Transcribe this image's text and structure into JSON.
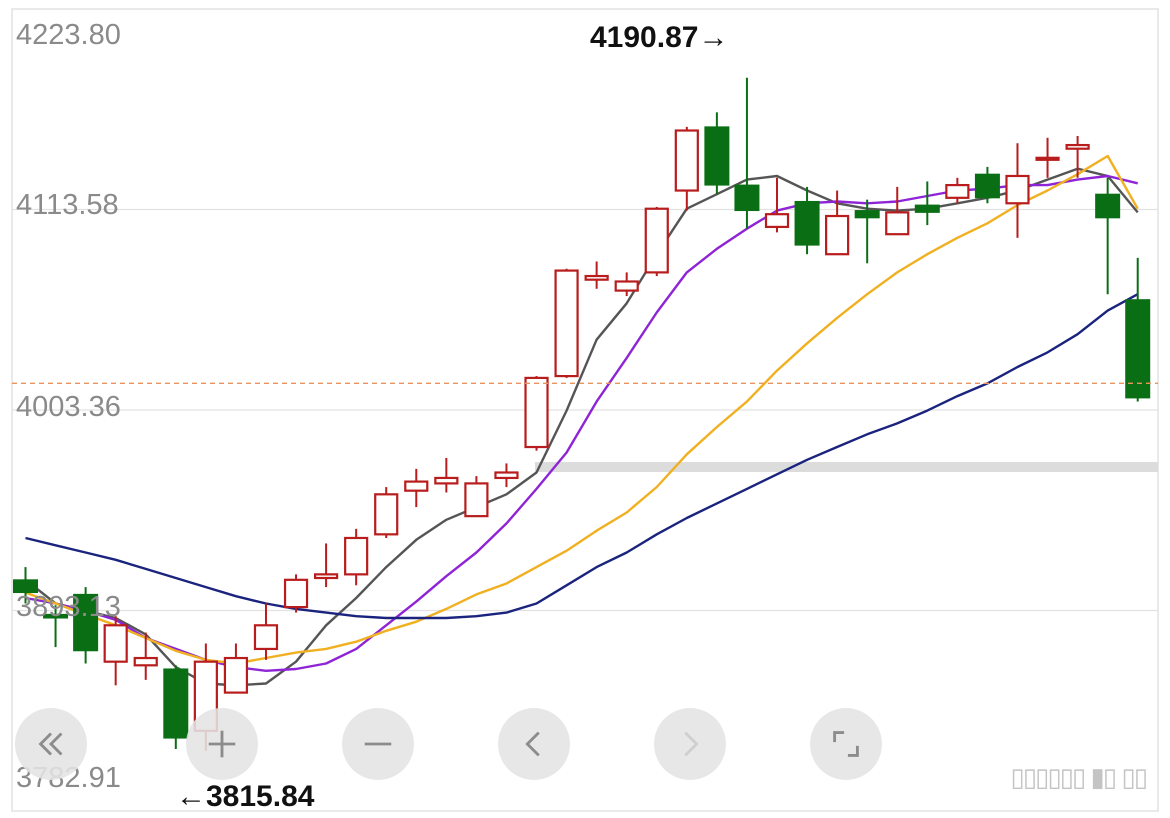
{
  "chart_data": {
    "type": "candlestick",
    "y_axis": {
      "ticks": [
        "4223.80",
        "4113.58",
        "4003.36",
        "3893.13",
        "3782.91"
      ],
      "ylim": [
        3782.91,
        4223.8
      ]
    },
    "annotations": {
      "high": "4190.87→",
      "low": "←3815.84"
    },
    "reference_line": 4018,
    "candles": [
      {
        "o": 3910,
        "c": 3903,
        "h": 3917,
        "l": 3897
      },
      {
        "o": 3891,
        "c": 3889,
        "h": 3896,
        "l": 3873
      },
      {
        "o": 3902,
        "c": 3871,
        "h": 3906,
        "l": 3864
      },
      {
        "o": 3865,
        "c": 3885,
        "h": 3890,
        "l": 3852
      },
      {
        "o": 3863,
        "c": 3867,
        "h": 3881,
        "l": 3855
      },
      {
        "o": 3861,
        "c": 3823,
        "h": 3863,
        "l": 3817
      },
      {
        "o": 3827,
        "c": 3865,
        "h": 3875,
        "l": 3816
      },
      {
        "o": 3848,
        "c": 3867,
        "h": 3875,
        "l": 3848
      },
      {
        "o": 3872,
        "c": 3885,
        "h": 3897,
        "l": 3866
      },
      {
        "o": 3895,
        "c": 3910,
        "h": 3913,
        "l": 3892
      },
      {
        "o": 3911,
        "c": 3913,
        "h": 3930,
        "l": 3906
      },
      {
        "o": 3913,
        "c": 3933,
        "h": 3938,
        "l": 3907
      },
      {
        "o": 3935,
        "c": 3957,
        "h": 3961,
        "l": 3933
      },
      {
        "o": 3959,
        "c": 3964,
        "h": 3971,
        "l": 3950
      },
      {
        "o": 3963,
        "c": 3966,
        "h": 3977,
        "l": 3958
      },
      {
        "o": 3945,
        "c": 3963,
        "h": 3967,
        "l": 3945
      },
      {
        "o": 3966,
        "c": 3969,
        "h": 3974,
        "l": 3961
      },
      {
        "o": 3983,
        "c": 4021,
        "h": 4022,
        "l": 3981
      },
      {
        "o": 4022,
        "c": 4080,
        "h": 4081,
        "l": 4021
      },
      {
        "o": 4075,
        "c": 4077,
        "h": 4085,
        "l": 4070
      },
      {
        "o": 4069,
        "c": 4074,
        "h": 4079,
        "l": 4066
      },
      {
        "o": 4079,
        "c": 4114,
        "h": 4115,
        "l": 4077
      },
      {
        "o": 4124,
        "c": 4157,
        "h": 4159,
        "l": 4113
      },
      {
        "o": 4159,
        "c": 4127,
        "h": 4167,
        "l": 4122
      },
      {
        "o": 4127,
        "c": 4113,
        "h": 4186,
        "l": 4103
      },
      {
        "o": 4104,
        "c": 4111,
        "h": 4131,
        "l": 4101
      },
      {
        "o": 4118,
        "c": 4094,
        "h": 4126,
        "l": 4089
      },
      {
        "o": 4089,
        "c": 4110,
        "h": 4124,
        "l": 4089
      },
      {
        "o": 4113,
        "c": 4109,
        "h": 4119,
        "l": 4084
      },
      {
        "o": 4100,
        "c": 4112,
        "h": 4126,
        "l": 4100
      },
      {
        "o": 4116,
        "c": 4112,
        "h": 4129,
        "l": 4105
      },
      {
        "o": 4120,
        "c": 4127,
        "h": 4131,
        "l": 4117
      },
      {
        "o": 4133,
        "c": 4120,
        "h": 4137,
        "l": 4117
      },
      {
        "o": 4117,
        "c": 4132,
        "h": 4150,
        "l": 4098
      },
      {
        "o": 4141,
        "c": 4142,
        "h": 4153,
        "l": 4131
      },
      {
        "o": 4147,
        "c": 4149,
        "h": 4154,
        "l": 4131
      },
      {
        "o": 4122,
        "c": 4109,
        "h": 4131,
        "l": 4067
      },
      {
        "o": 4064,
        "c": 4010,
        "h": 4087,
        "l": 4008
      }
    ],
    "series": [
      {
        "color": "#555555",
        "values": [
          3910,
          3897,
          3893,
          3889,
          3880,
          3862,
          3853,
          3852,
          3853,
          3865,
          3885,
          3900,
          3917,
          3932,
          3943,
          3950,
          3957,
          3969,
          4003,
          4042,
          4062,
          4089,
          4114,
          4122,
          4130,
          4132,
          4124,
          4117,
          4114,
          4113,
          4114,
          4117,
          4120,
          4124,
          4130,
          4136,
          4132,
          4112
        ]
      },
      {
        "color": "#8e24d6",
        "values": [
          3900,
          3897,
          3893,
          3888,
          3878,
          3872,
          3866,
          3862,
          3860,
          3861,
          3864,
          3872,
          3885,
          3898,
          3912,
          3925,
          3941,
          3960,
          3980,
          4008,
          4032,
          4057,
          4079,
          4092,
          4103,
          4113,
          4117,
          4118,
          4117,
          4118,
          4121,
          4124,
          4125,
          4127,
          4127,
          4130,
          4132,
          4128
        ]
      },
      {
        "color": "#f0b020",
        "values": [
          3903,
          3897,
          3891,
          3885,
          3878,
          3871,
          3866,
          3864,
          3867,
          3870,
          3872,
          3876,
          3882,
          3887,
          3894,
          3902,
          3908,
          3917,
          3926,
          3937,
          3947,
          3961,
          3979,
          3994,
          4008,
          4025,
          4040,
          4054,
          4067,
          4079,
          4089,
          4098,
          4106,
          4116,
          4124,
          4133,
          4143,
          4114
        ]
      },
      {
        "color": "#1a237e",
        "values": [
          3933,
          3929,
          3925,
          3921,
          3916,
          3911,
          3906,
          3901,
          3897,
          3894,
          3892,
          3890,
          3889,
          3889,
          3889,
          3890,
          3892,
          3897,
          3907,
          3917,
          3925,
          3935,
          3944,
          3952,
          3960,
          3968,
          3976,
          3983,
          3990,
          3996,
          4003,
          4011,
          4018,
          4027,
          4035,
          4045,
          4058,
          4067
        ]
      }
    ]
  },
  "toolbar": {
    "buttons": [
      {
        "name": "rewind-button",
        "icon": "double-chevron-left-icon"
      },
      {
        "name": "zoom-in-button",
        "icon": "plus-icon"
      },
      {
        "name": "zoom-out-button",
        "icon": "minus-icon"
      },
      {
        "name": "previous-button",
        "icon": "chevron-left-icon"
      },
      {
        "name": "next-button",
        "icon": "chevron-right-icon"
      },
      {
        "name": "fullscreen-button",
        "icon": "expand-corners-icon"
      }
    ]
  },
  "colors": {
    "up": "#b81c1c",
    "down": "#0a6e14",
    "grid": "#e2e2e2",
    "ref": "#e8945c"
  }
}
